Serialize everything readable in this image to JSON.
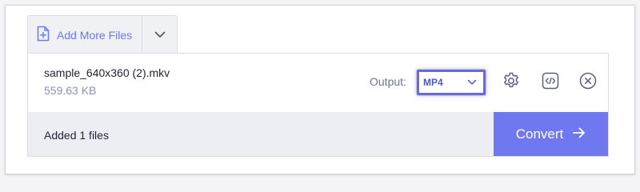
{
  "toolbar": {
    "add_files_label": "Add More Files",
    "add_files_icon": "file-plus-icon",
    "dropdown_icon": "chevron-down-icon"
  },
  "file": {
    "name": "sample_640x360 (2).mkv",
    "size": "559.63 KB",
    "output_label": "Output:",
    "format": "MP4",
    "actions": [
      "gear-icon",
      "embed-code-icon",
      "close-circle-icon"
    ]
  },
  "footer": {
    "status": "Added 1 files",
    "convert_label": "Convert",
    "convert_icon": "arrow-right-icon"
  },
  "colors": {
    "accent": "#6f78ee",
    "link": "#6b78ee",
    "select_border": "#6a6ad8",
    "footer_bg": "#eceef3"
  }
}
